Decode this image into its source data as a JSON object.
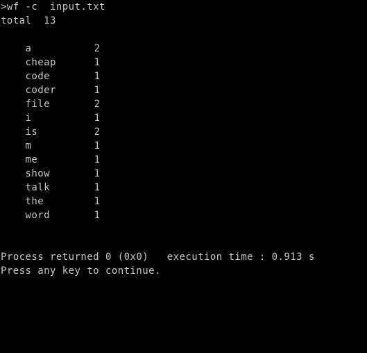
{
  "terminal": {
    "background_color": "#000000",
    "text_color": "#c7c7c7",
    "prompt_line": ">wf -c  input.txt",
    "total_line": "total  13",
    "word_counts": [
      {
        "word": "a",
        "count": "2"
      },
      {
        "word": "cheap",
        "count": "1"
      },
      {
        "word": "code",
        "count": "1"
      },
      {
        "word": "coder",
        "count": "1"
      },
      {
        "word": "file",
        "count": "2"
      },
      {
        "word": "i",
        "count": "1"
      },
      {
        "word": "is",
        "count": "2"
      },
      {
        "word": "m",
        "count": "1"
      },
      {
        "word": "me",
        "count": "1"
      },
      {
        "word": "show",
        "count": "1"
      },
      {
        "word": "talk",
        "count": "1"
      },
      {
        "word": "the",
        "count": "1"
      },
      {
        "word": "word",
        "count": "1"
      }
    ],
    "footer": {
      "process_line": "Process returned 0 (0x0)   execution time : 0.913 s",
      "press_any_key_line": "Press any key to continue."
    }
  }
}
